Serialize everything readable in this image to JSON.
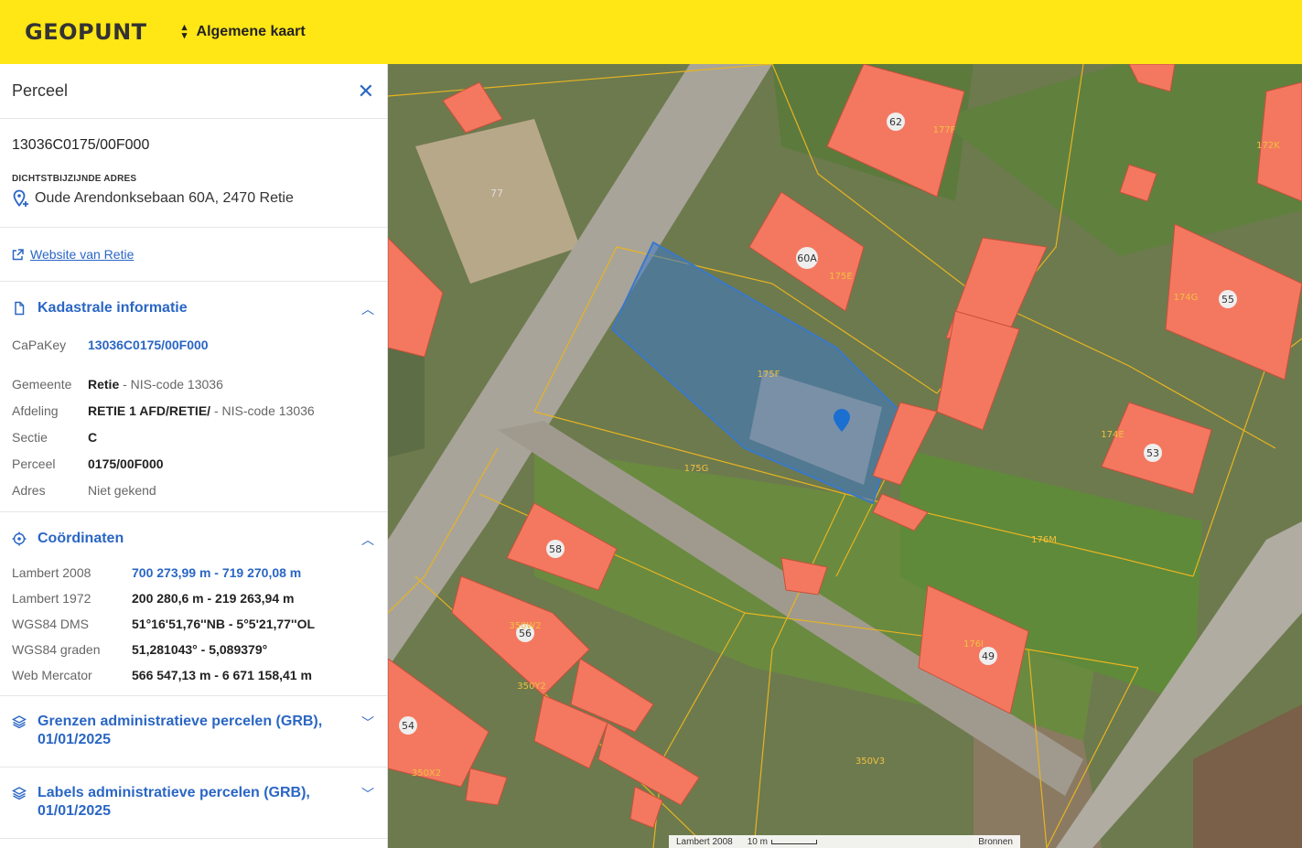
{
  "header": {
    "logo": "GEOPUNT",
    "map_selector": "Algemene kaart"
  },
  "panel": {
    "title": "Perceel",
    "parcel_id": "13036C0175/00F000",
    "address_caption": "DICHTSTBIJZIJNDE ADRES",
    "address": "Oude Arendonksebaan 60A, 2470 Retie",
    "website_link": "Website van Retie",
    "cadastral": {
      "title": "Kadastrale informatie",
      "capakey_label": "CaPaKey",
      "capakey_value": "13036C0175/00F000",
      "gemeente_label": "Gemeente",
      "gemeente_value": "Retie",
      "gemeente_nis": " - NIS-code 13036",
      "afdeling_label": "Afdeling",
      "afdeling_value": "RETIE 1 AFD/RETIE/",
      "afdeling_nis": " - NIS-code 13036",
      "sectie_label": "Sectie",
      "sectie_value": "C",
      "perceel_label": "Perceel",
      "perceel_value": "0175/00F000",
      "adres_label": "Adres",
      "adres_value": "Niet gekend"
    },
    "coordinates": {
      "title": "Coördinaten",
      "rows": [
        {
          "label": "Lambert 2008",
          "value": "700 273,99 m - 719 270,08 m"
        },
        {
          "label": "Lambert 1972",
          "value": "200 280,6 m - 219 263,94 m"
        },
        {
          "label": "WGS84 DMS",
          "value": "51°16'51,76''NB - 5°5'21,77''OL"
        },
        {
          "label": "WGS84 graden",
          "value": "51,281043° - 5,089379°"
        },
        {
          "label": "Web Mercator",
          "value": "566 547,13 m - 6 671 158,41 m"
        }
      ]
    },
    "layers": [
      {
        "title": "Grenzen administratieve percelen (GRB), 01/01/2025"
      },
      {
        "title": "Labels administratieve percelen (GRB), 01/01/2025"
      }
    ]
  },
  "map": {
    "house_labels": [
      "62",
      "60A",
      "55",
      "53",
      "58",
      "56",
      "49",
      "54",
      "77"
    ],
    "parcel_labels": [
      "175F",
      "175E",
      "175G",
      "174G",
      "174E",
      "176M",
      "176I",
      "350W2",
      "350Y2",
      "350V3",
      "350X2",
      "177F",
      "172K"
    ],
    "scalebar": {
      "projection": "Lambert 2008",
      "scale": "10 m",
      "sources": "Bronnen"
    },
    "colors": {
      "building": "#f47860",
      "selection": "#3a78c8",
      "parcel_line": "#e8b420",
      "marker": "#1a6fd0"
    }
  },
  "icons": {
    "close": "close-icon",
    "address": "location-plus-icon",
    "external": "external-link-icon",
    "cadastral": "document-icon",
    "coordinates": "crosshair-icon",
    "layer": "layers-icon",
    "chevron": "chevron-icon"
  }
}
